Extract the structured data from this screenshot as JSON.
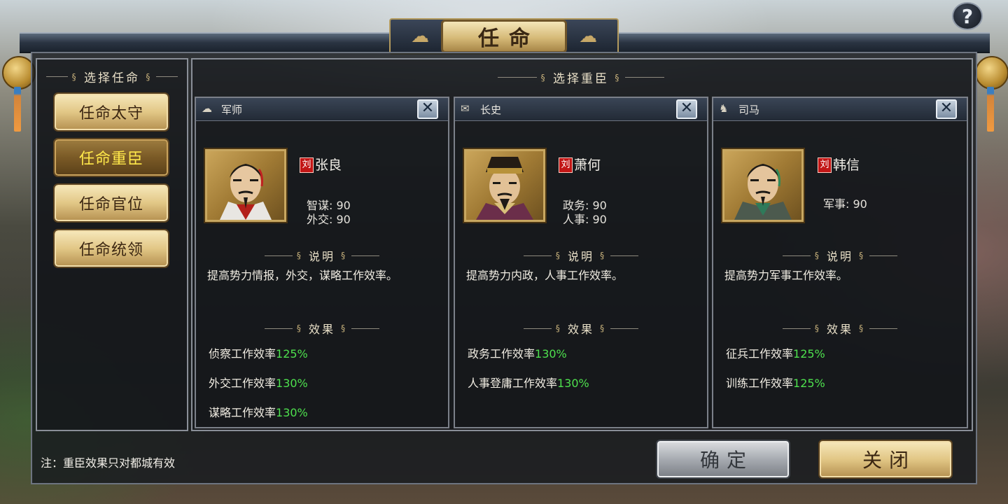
{
  "window": {
    "title": "任命",
    "help_label": "?"
  },
  "left": {
    "section_title": "选择任命",
    "menu": [
      {
        "label": "任命太守",
        "active": false
      },
      {
        "label": "任命重臣",
        "active": true
      },
      {
        "label": "任命官位",
        "active": false
      },
      {
        "label": "任命统领",
        "active": false
      }
    ]
  },
  "right": {
    "section_title": "选择重臣"
  },
  "cards": [
    {
      "role": "军师",
      "role_icon": "sheep-icon",
      "faction": "刘",
      "name": "张良",
      "stats": [
        "智谋: 90",
        "外交: 90"
      ],
      "desc_title": "说明",
      "desc": "提高势力情报，外交，谋略工作效率。",
      "effect_title": "效果",
      "effects": [
        {
          "label": "侦察工作效率",
          "pct": "125%"
        },
        {
          "label": "外交工作效率",
          "pct": "130%"
        },
        {
          "label": "谋略工作效率",
          "pct": "130%"
        }
      ]
    },
    {
      "role": "长史",
      "role_icon": "scroll-icon",
      "faction": "刘",
      "name": "萧何",
      "stats": [
        "政务: 90",
        "人事: 90"
      ],
      "desc_title": "说明",
      "desc": "提高势力内政，人事工作效率。",
      "effect_title": "效果",
      "effects": [
        {
          "label": "政务工作效率",
          "pct": "130%"
        },
        {
          "label": "人事登庸工作效率",
          "pct": "130%"
        }
      ]
    },
    {
      "role": "司马",
      "role_icon": "horse-icon",
      "faction": "刘",
      "name": "韩信",
      "stats": [
        "军事: 90"
      ],
      "desc_title": "说明",
      "desc": "提高势力军事工作效率。",
      "effect_title": "效果",
      "effects": [
        {
          "label": "征兵工作效率",
          "pct": "125%"
        },
        {
          "label": "训练工作效率",
          "pct": "125%"
        }
      ]
    }
  ],
  "footer": {
    "note": "注：重臣效果只对都城有效",
    "confirm_label": "确定",
    "close_label": "关闭"
  },
  "colors": {
    "percent_green": "#4ee04e",
    "active_menu_text": "#ffe84a",
    "faction_red": "#c21616"
  }
}
